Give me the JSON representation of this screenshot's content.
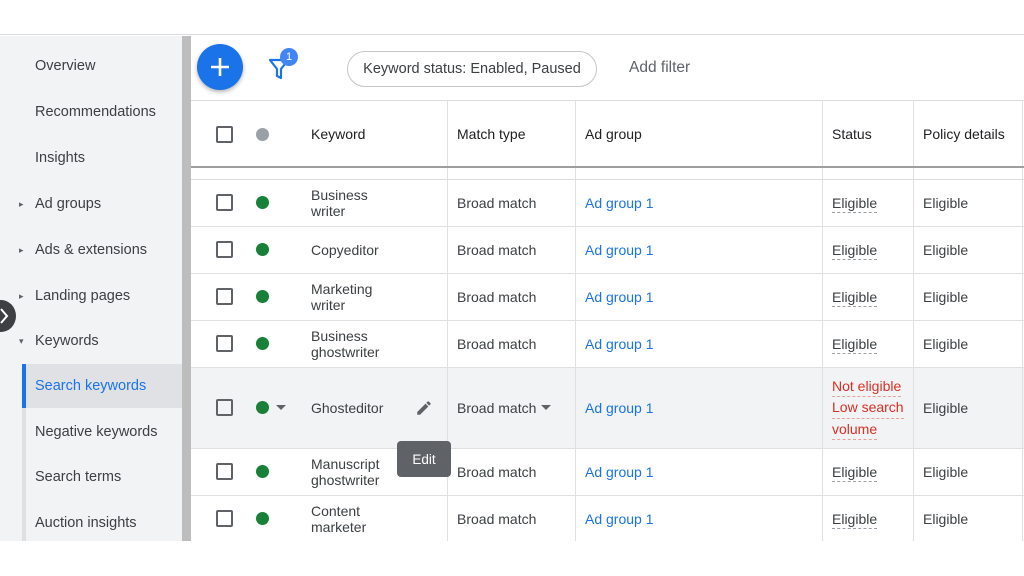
{
  "sidebar": {
    "items": [
      {
        "label": "Overview",
        "arrow": ""
      },
      {
        "label": "Recommendations",
        "arrow": ""
      },
      {
        "label": "Insights",
        "arrow": ""
      },
      {
        "label": "Ad groups",
        "arrow": "▸"
      },
      {
        "label": "Ads & extensions",
        "arrow": "▸"
      },
      {
        "label": "Landing pages",
        "arrow": "▸"
      },
      {
        "label": "Keywords",
        "arrow": "▾"
      }
    ],
    "sub_items": [
      {
        "label": "Search keywords",
        "active": true
      },
      {
        "label": "Negative keywords",
        "active": false
      },
      {
        "label": "Search terms",
        "active": false
      },
      {
        "label": "Auction insights",
        "active": false
      }
    ]
  },
  "toolbar": {
    "filter_count": "1",
    "filter_chip": "Keyword status: Enabled, Paused",
    "add_filter": "Add filter"
  },
  "table": {
    "headers": {
      "keyword": "Keyword",
      "match_type": "Match type",
      "ad_group": "Ad group",
      "status": "Status",
      "policy": "Policy details"
    },
    "rows": [
      {
        "keyword": "Business writer",
        "kw_l1": "Business",
        "kw_l2": "writer",
        "match_type": "Broad match",
        "ad_group": "Ad group 1",
        "status": "Eligible",
        "policy": "Eligible"
      },
      {
        "keyword": "Copyeditor",
        "kw_l1": "Copyeditor",
        "kw_l2": "",
        "match_type": "Broad match",
        "ad_group": "Ad group 1",
        "status": "Eligible",
        "policy": "Eligible"
      },
      {
        "keyword": "Marketing writer",
        "kw_l1": "Marketing",
        "kw_l2": "writer",
        "match_type": "Broad match",
        "ad_group": "Ad group 1",
        "status": "Eligible",
        "policy": "Eligible"
      },
      {
        "keyword": "Business ghostwriter",
        "kw_l1": "Business",
        "kw_l2": "ghostwriter",
        "match_type": "Broad match",
        "ad_group": "Ad group 1",
        "status": "Eligible",
        "policy": "Eligible"
      },
      {
        "keyword": "Ghosteditor",
        "kw_l1": "Ghosteditor",
        "kw_l2": "",
        "match_type": "Broad match",
        "ad_group": "Ad group 1",
        "status_lines": [
          "Not eligible",
          "Low search",
          "volume"
        ],
        "policy": "Eligible"
      },
      {
        "keyword": "Manuscript ghostwriter",
        "kw_l1": "Manuscript",
        "kw_l2": "ghostwriter",
        "match_type": "Broad match",
        "ad_group": "Ad group 1",
        "status": "Eligible",
        "policy": "Eligible"
      },
      {
        "keyword": "Content marketer",
        "kw_l1": "Content",
        "kw_l2": "marketer",
        "match_type": "Broad match",
        "ad_group": "Ad group 1",
        "status": "Eligible",
        "policy": "Eligible"
      }
    ]
  },
  "tooltip": {
    "label": "Edit"
  },
  "colors": {
    "accent": "#1a73e8",
    "eligible_dot": "#188038",
    "not_eligible": "#d93025"
  },
  "icons": [
    "plus-icon",
    "filter-icon",
    "chevron-right-icon",
    "pencil-icon",
    "caret-down-icon",
    "arrow-right-icon",
    "arrow-down-icon"
  ]
}
